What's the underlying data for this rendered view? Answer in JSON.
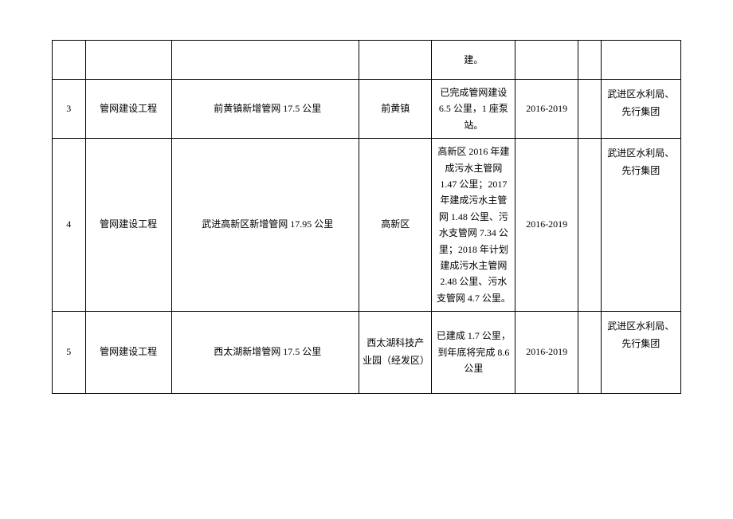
{
  "rows": {
    "top_partial": {
      "status": "建。"
    },
    "r3": {
      "idx": "3",
      "proj": "管网建设工程",
      "desc": "前黄镇新增管网 17.5 公里",
      "loc": "前黄镇",
      "status": "已完成管网建设 6.5 公里，1 座泵站。",
      "year": "2016-2019",
      "org": "武进区水利局、先行集团"
    },
    "r4": {
      "idx": "4",
      "proj": "管网建设工程",
      "desc": "武进高新区新增管网 17.95 公里",
      "loc": "高新区",
      "status": "高新区 2016 年建成污水主管网 1.47 公里；2017 年建成污水主管网 1.48 公里、污水支管网 7.34 公里；2018 年计划建成污水主管网 2.48 公里、污水支管网 4.7 公里。",
      "year": "2016-2019",
      "org": "武进区水利局、先行集团"
    },
    "r5": {
      "idx": "5",
      "proj": "管网建设工程",
      "desc": "西太湖新增管网 17.5 公里",
      "loc": "西太湖科技产业园（经发区）",
      "status": "已建成 1.7 公里，到年底将完成 8.6 公里",
      "year": "2016-2019",
      "org": "武进区水利局、先行集团"
    }
  }
}
